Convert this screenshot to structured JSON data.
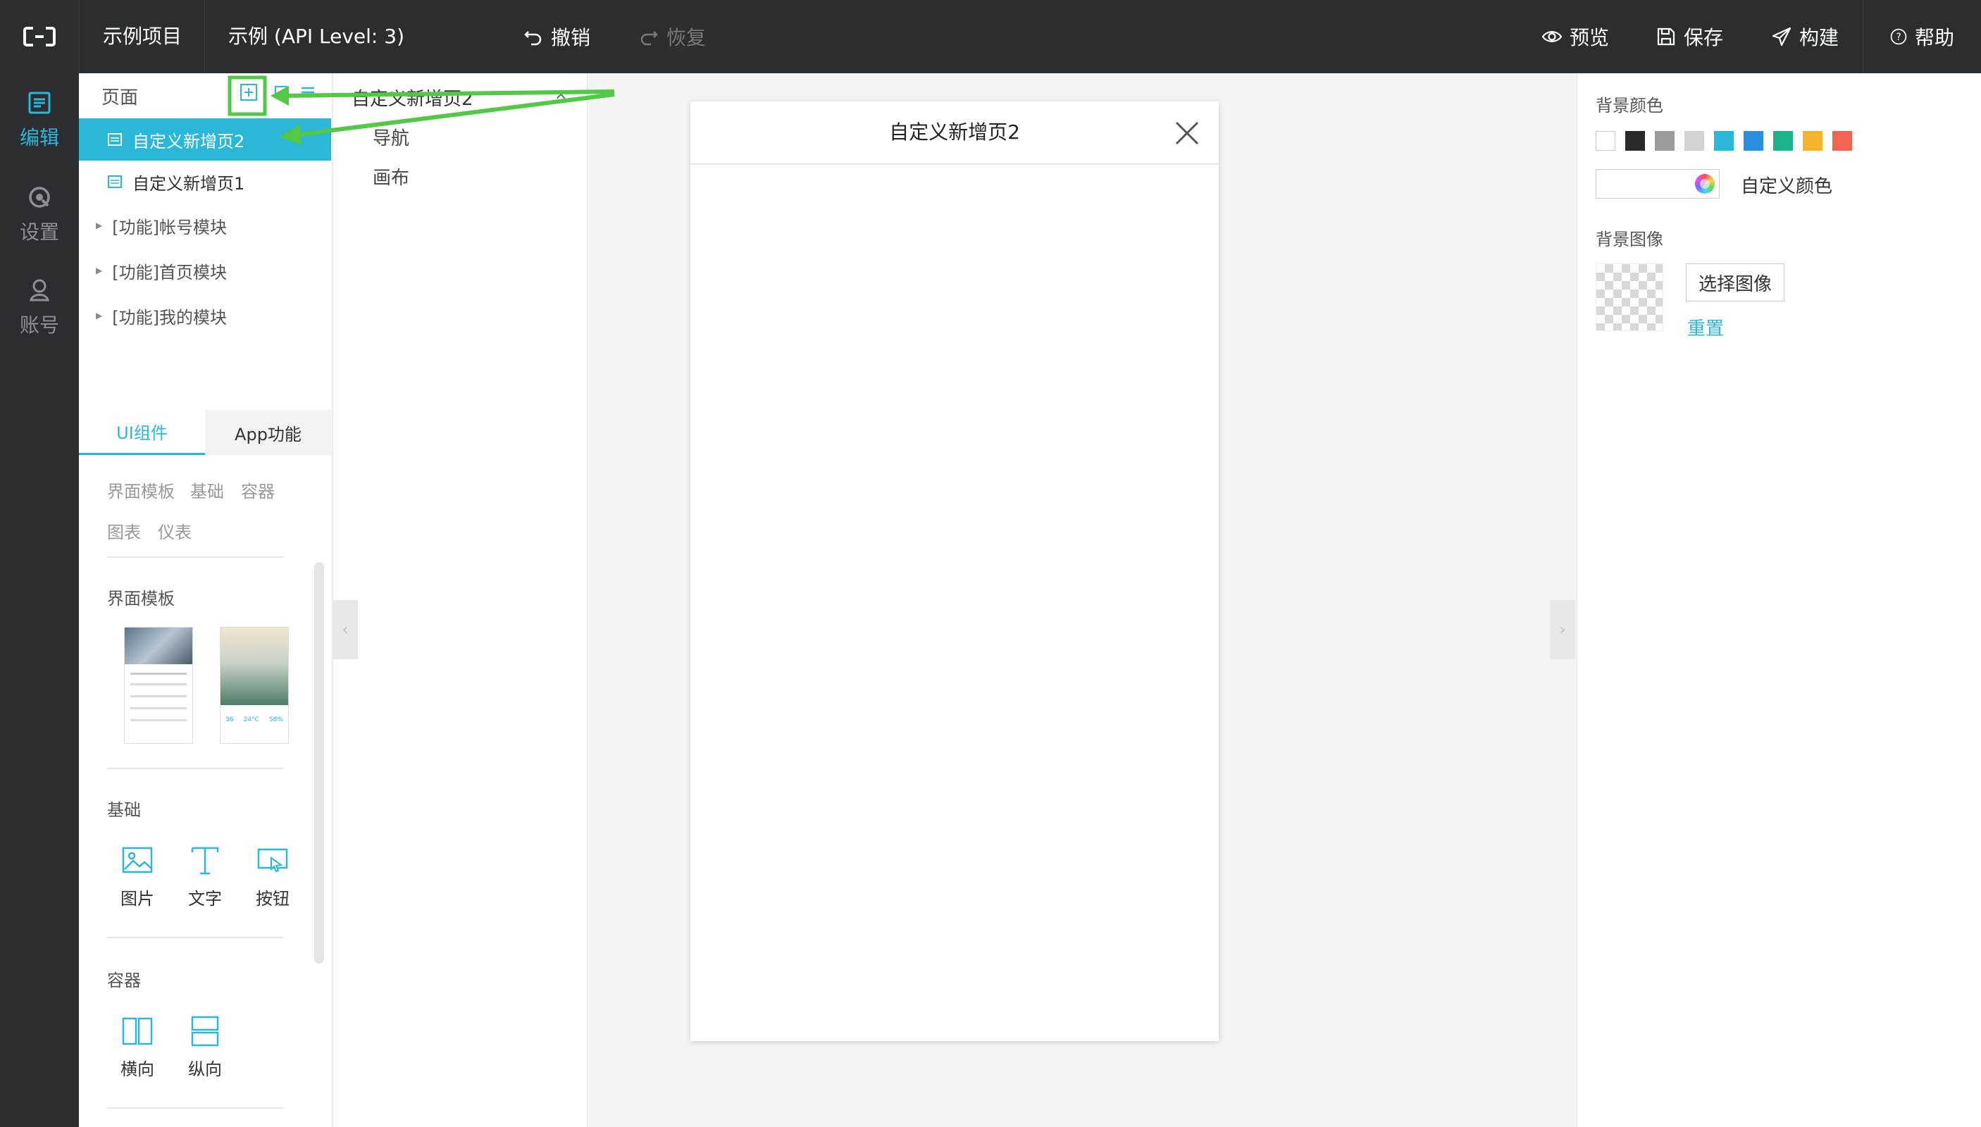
{
  "topbar": {
    "project_name": "示例项目",
    "app_title": "示例 (API Level: 3)",
    "undo_label": "撤销",
    "redo_label": "恢复",
    "preview_label": "预览",
    "save_label": "保存",
    "build_label": "构建",
    "help_label": "帮助"
  },
  "leftnav": {
    "items": [
      {
        "label": "编辑",
        "icon": "edit-icon",
        "active": true
      },
      {
        "label": "设置",
        "icon": "settings-icon",
        "active": false
      },
      {
        "label": "账号",
        "icon": "account-icon",
        "active": false
      }
    ]
  },
  "pages_panel": {
    "title": "页面",
    "pages": [
      {
        "label": "自定义新增页2",
        "active": true
      },
      {
        "label": "自定义新增页1",
        "active": false
      }
    ],
    "groups": [
      "[功能]帐号模块",
      "[功能]首页模块",
      "[功能]我的模块"
    ]
  },
  "component_panel": {
    "tabs": [
      {
        "label": "UI组件",
        "active": true
      },
      {
        "label": "App功能",
        "active": false
      }
    ],
    "categories": [
      "界面模板",
      "基础",
      "容器",
      "图表",
      "仪表"
    ],
    "sections": {
      "templates_title": "界面模板",
      "template_thumb_values": [
        "36",
        "24°C",
        "58%"
      ],
      "basic_title": "基础",
      "basic_items": [
        "图片",
        "文字",
        "按钮"
      ],
      "container_title": "容器",
      "container_items": [
        "横向",
        "纵向"
      ]
    }
  },
  "outline_panel": {
    "tab_title": "自定义新增页2",
    "close_glyph": "×",
    "items": [
      "导航",
      "画布"
    ]
  },
  "canvas": {
    "page_title": "自定义新增页2"
  },
  "properties_panel": {
    "bg_color_label": "背景颜色",
    "swatches": [
      "#ffffff",
      "#2b2b2b",
      "#9b9b9b",
      "#d2d2d2",
      "#2bb8d8",
      "#2a8fe0",
      "#1bb38a",
      "#f5b32e",
      "#f06454"
    ],
    "custom_color_label": "自定义颜色",
    "bg_image_label": "背景图像",
    "choose_image_label": "选择图像",
    "reset_label": "重置"
  },
  "colors": {
    "accent": "#2bb8d8",
    "topbar_bg": "#2b2d30",
    "annotation": "#52c846"
  }
}
